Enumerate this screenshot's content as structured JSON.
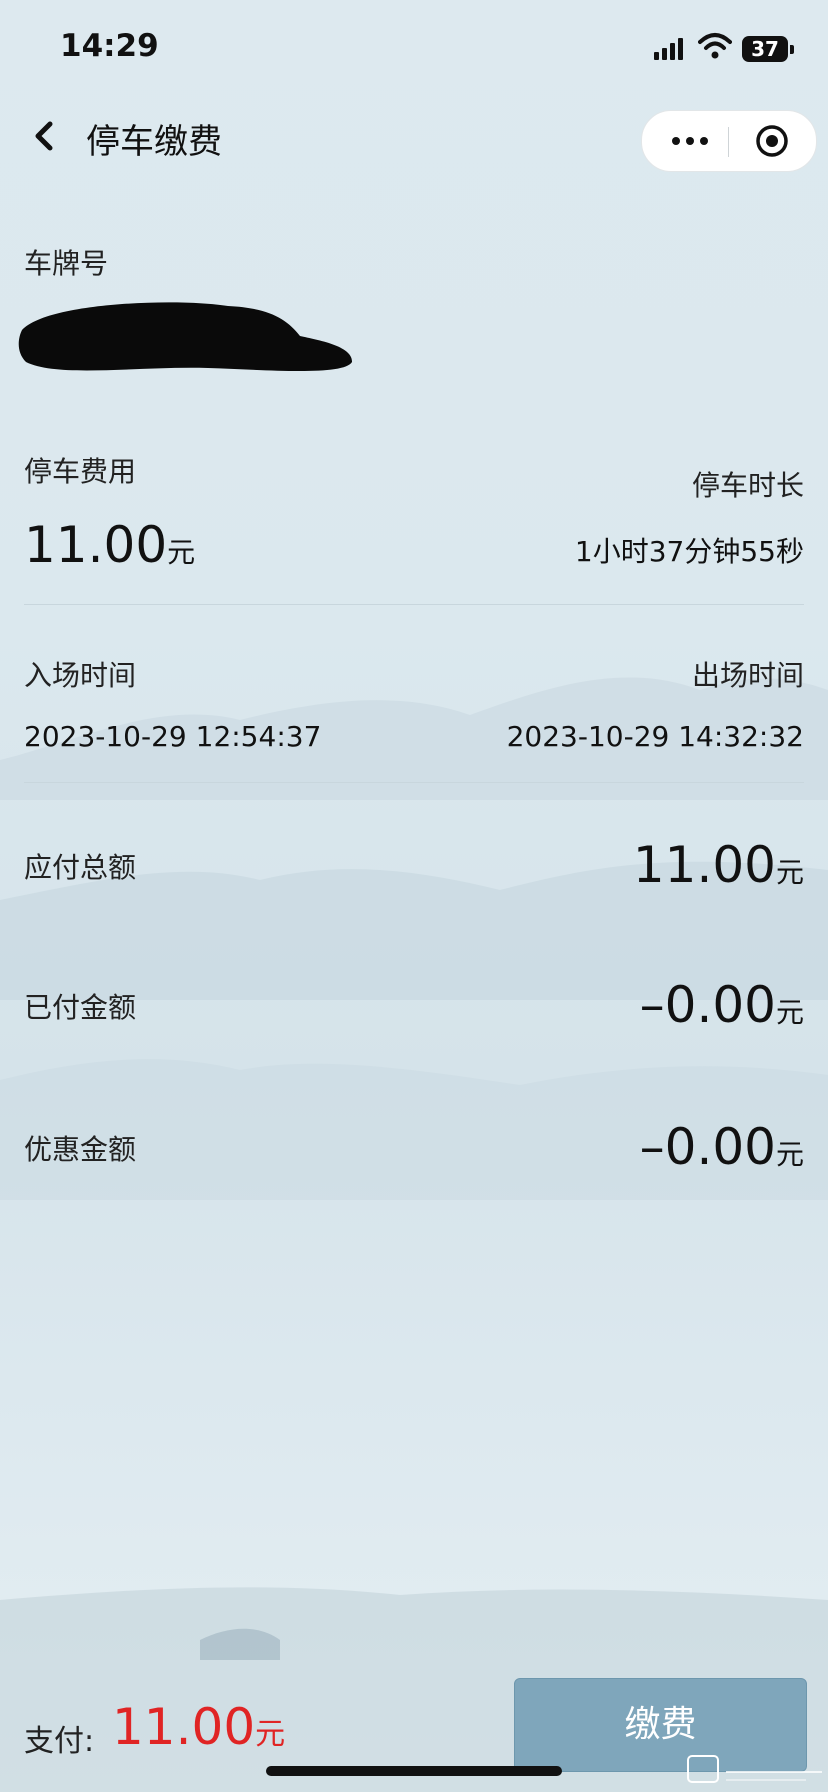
{
  "status_bar": {
    "time": "14:29",
    "battery": "37"
  },
  "nav": {
    "title": "停车缴费"
  },
  "plate": {
    "label": "车牌号",
    "value_redacted": true
  },
  "parking_fee": {
    "label": "停车费用",
    "amount": "11.00",
    "unit": "元"
  },
  "duration": {
    "label": "停车时长",
    "value": "1小时37分钟55秒"
  },
  "entry": {
    "label": "入场时间",
    "value": "2023-10-29 12:54:37"
  },
  "exit": {
    "label": "出场时间",
    "value": "2023-10-29 14:32:32"
  },
  "payable": {
    "label": "应付总额",
    "amount": "11.00",
    "unit": "元"
  },
  "paid": {
    "label": "已付金额",
    "amount": "–0.00",
    "unit": "元"
  },
  "discount": {
    "label": "优惠金额",
    "amount": "–0.00",
    "unit": "元"
  },
  "footer": {
    "pay_label": "支付:",
    "pay_amount": "11.00",
    "unit": "元",
    "button_label": "缴费"
  },
  "colors": {
    "accent_red": "#e02424",
    "button": "#7fa6bb"
  }
}
